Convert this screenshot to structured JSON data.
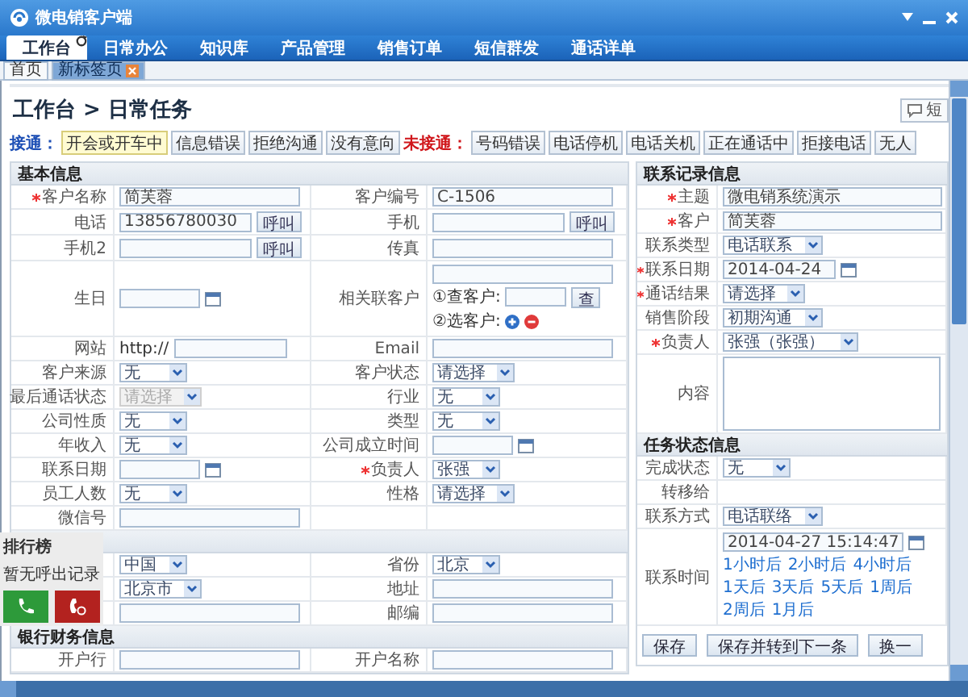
{
  "window": {
    "title": "微电销客户端"
  },
  "nav_tabs": [
    {
      "label": "工作台",
      "selected": true
    },
    {
      "label": "日常办公",
      "selected": false
    },
    {
      "label": "知识库",
      "selected": false
    },
    {
      "label": "产品管理",
      "selected": false
    },
    {
      "label": "销售订单",
      "selected": false
    },
    {
      "label": "短信群发",
      "selected": false
    },
    {
      "label": "通话详单",
      "selected": false
    }
  ],
  "page_tabs": [
    {
      "label": "首页",
      "selected": false,
      "closable": false
    },
    {
      "label": "新标签页",
      "selected": true,
      "closable": true
    }
  ],
  "breadcrumb": "工作台 > 日常任务",
  "sms_button": {
    "label": "短"
  },
  "outcome_groups": [
    {
      "label": "接通：",
      "connected": true,
      "buttons": [
        {
          "label": "开会或开车中",
          "selected": true
        },
        {
          "label": "信息错误",
          "selected": false
        },
        {
          "label": "拒绝沟通",
          "selected": false
        },
        {
          "label": "没有意向",
          "selected": false
        }
      ]
    },
    {
      "label": "未接通：",
      "connected": false,
      "buttons": [
        {
          "label": "号码错误",
          "selected": false
        },
        {
          "label": "电话停机",
          "selected": false
        },
        {
          "label": "电话关机",
          "selected": false
        },
        {
          "label": "正在通话中",
          "selected": false
        },
        {
          "label": "拒接电话",
          "selected": false
        },
        {
          "label": "无人",
          "selected": false
        }
      ]
    }
  ],
  "basic_info": {
    "title": "基本信息",
    "rows": [
      [
        {
          "label": "客户名称",
          "required": true,
          "kind": "text",
          "value": "简芙蓉"
        },
        {
          "label": "客户编号",
          "required": false,
          "kind": "text",
          "value": "C-1506"
        }
      ],
      [
        {
          "label": "电话",
          "required": false,
          "kind": "text",
          "value": "13856780030",
          "button": "呼叫"
        },
        {
          "label": "手机",
          "required": false,
          "kind": "text",
          "button": "呼叫"
        }
      ],
      [
        {
          "label": "手机2",
          "required": false,
          "kind": "text",
          "button": "呼叫"
        },
        {
          "label": "传真",
          "required": false,
          "kind": "text"
        }
      ],
      [
        {
          "label": "生日",
          "required": false,
          "kind": "date"
        },
        {
          "label": "相关联客户",
          "required": false,
          "kind": "related",
          "search_label": "①查客户:",
          "search_button": "查",
          "pick_label": "②选客户:"
        }
      ],
      [
        {
          "label": "网站",
          "required": false,
          "kind": "url",
          "prefix": "http://"
        },
        {
          "label": "Email",
          "required": false,
          "kind": "text"
        }
      ],
      [
        {
          "label": "客户来源",
          "required": false,
          "kind": "select",
          "value": "无",
          "disabled": false
        },
        {
          "label": "客户状态",
          "required": false,
          "kind": "select",
          "value": "请选择",
          "disabled": false
        }
      ],
      [
        {
          "label": "最后通话状态",
          "required": false,
          "kind": "select",
          "value": "请选择",
          "disabled": true
        },
        {
          "label": "行业",
          "required": false,
          "kind": "select",
          "value": "无",
          "disabled": false
        }
      ],
      [
        {
          "label": "公司性质",
          "required": false,
          "kind": "select",
          "value": "无",
          "disabled": false
        },
        {
          "label": "类型",
          "required": false,
          "kind": "select",
          "value": "无",
          "disabled": false
        }
      ],
      [
        {
          "label": "年收入",
          "required": false,
          "kind": "select",
          "value": "无",
          "disabled": false
        },
        {
          "label": "公司成立时间",
          "required": false,
          "kind": "date"
        }
      ],
      [
        {
          "label": "联系日期",
          "required": false,
          "kind": "date"
        },
        {
          "label": "负责人",
          "required": true,
          "kind": "select",
          "value": "张强",
          "disabled": false
        }
      ],
      [
        {
          "label": "员工人数",
          "required": false,
          "kind": "select",
          "value": "无",
          "disabled": false
        },
        {
          "label": "性格",
          "required": false,
          "kind": "select",
          "value": "请选择",
          "disabled": false
        }
      ],
      [
        {
          "label": "微信号",
          "required": false,
          "kind": "text"
        }
      ]
    ]
  },
  "address_info": {
    "rows": [
      [
        {
          "kind": "select",
          "value": "中国",
          "disabled": false
        },
        {
          "label": "省份",
          "required": false,
          "kind": "select",
          "value": "北京",
          "disabled": false
        }
      ],
      [
        {
          "kind": "select",
          "value": "北京市",
          "disabled": false
        },
        {
          "label": "地址",
          "required": false,
          "kind": "text"
        }
      ],
      [
        {
          "kind": "text"
        },
        {
          "label": "邮编",
          "required": false,
          "kind": "text"
        }
      ]
    ]
  },
  "bank_info": {
    "title": "银行财务信息",
    "rows": [
      [
        {
          "label": "开户行",
          "required": false,
          "kind": "text"
        },
        {
          "label": "开户名称",
          "required": false,
          "kind": "text"
        }
      ]
    ]
  },
  "contact_record": {
    "title": "联系记录信息",
    "rows": [
      {
        "label": "主题",
        "required": true,
        "kind": "text",
        "value": "微电销系统演示"
      },
      {
        "label": "客户",
        "required": true,
        "kind": "text",
        "value": "简芙蓉"
      },
      {
        "label": "联系类型",
        "required": false,
        "kind": "select",
        "value": "电话联系",
        "disabled": false
      },
      {
        "label": "联系日期",
        "required": true,
        "kind": "date",
        "value": "2014-04-24"
      },
      {
        "label": "通话结果",
        "required": true,
        "kind": "select",
        "value": "请选择",
        "disabled": false
      },
      {
        "label": "销售阶段",
        "required": false,
        "kind": "select",
        "value": "初期沟通",
        "disabled": false
      },
      {
        "label": "负责人",
        "required": true,
        "kind": "select",
        "value": "张强（张强）",
        "disabled": false
      },
      {
        "label": "内容",
        "required": false,
        "kind": "textarea"
      }
    ]
  },
  "task_status": {
    "title": "任务状态信息",
    "rows": [
      {
        "label": "完成状态",
        "required": false,
        "kind": "select",
        "value": "无",
        "disabled": false
      },
      {
        "label": "转移给",
        "required": false,
        "kind": "none"
      },
      {
        "label": "联系方式",
        "required": false,
        "kind": "select",
        "value": "电话联络",
        "disabled": false
      },
      {
        "label": "联系时间",
        "required": false,
        "kind": "datetime",
        "value": "2014-04-27 15:14:47",
        "quick_links": [
          "1小时后",
          "2小时后",
          "4小时后",
          "1天后",
          "3天后",
          "5天后",
          "1周后",
          "2周后",
          "1月后"
        ]
      }
    ]
  },
  "actions": [
    "保存",
    "保存并转到下一条",
    "换一"
  ],
  "call_panel": {
    "title": "排行榜",
    "message": "暂无呼出记录"
  }
}
